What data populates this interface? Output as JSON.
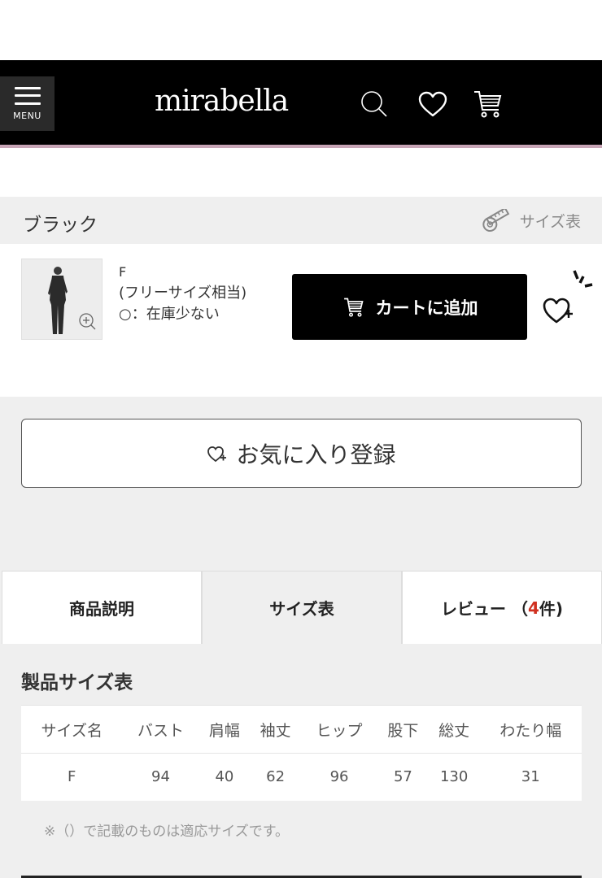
{
  "header": {
    "menu_label": "MENU",
    "logo": "mirabella"
  },
  "color": {
    "name": "ブラック",
    "size_chart_link": "サイズ表"
  },
  "variant": {
    "size": "F",
    "size_note": "(フリーサイズ相当)",
    "stock": "○：在庫少ない",
    "add_to_cart": "カートに追加"
  },
  "favorite_button": "お気に入り登録",
  "tabs": {
    "description": "商品説明",
    "size_chart": "サイズ表",
    "review_prefix": "レビュー （",
    "review_count": "4",
    "review_suffix": "件)"
  },
  "size_table": {
    "title": "製品サイズ表",
    "headers": [
      "サイズ名",
      "バスト",
      "肩幅",
      "袖丈",
      "ヒップ",
      "股下",
      "総丈",
      "わたり幅"
    ],
    "rows": [
      [
        "F",
        "94",
        "40",
        "62",
        "96",
        "57",
        "130",
        "31"
      ]
    ],
    "note": "※（）で記載のものは適応サイズです。"
  },
  "colors": {
    "header_bg": "#000000",
    "accent_line": "#c8a5b6",
    "review_count": "#d03020"
  }
}
